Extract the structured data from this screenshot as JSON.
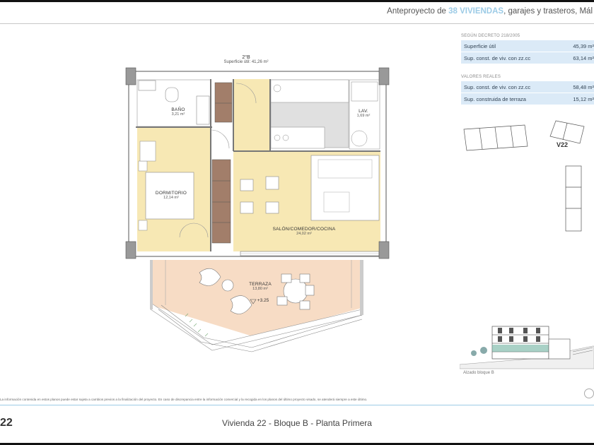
{
  "header": {
    "title_pre": "Anteproyecto de ",
    "title_highlight": "38 VIVIENDAS",
    "title_post": ", garajes y trasteros, Mál"
  },
  "plan": {
    "unit_label": "2°B",
    "unit_area": "Superficie útil: 41,26 m²",
    "rooms": [
      {
        "name": "BAÑO",
        "area": "3,21 m²"
      },
      {
        "name": "LAV.",
        "area": "1,69 m²"
      },
      {
        "name": "DORMITORIO",
        "area": "12,14 m²"
      },
      {
        "name": "SALÓN/COMEDOR/COCINA",
        "area": "24,02 m²"
      },
      {
        "name": "TERRAZA",
        "area": "13,80 m²"
      }
    ],
    "level": "+3.25"
  },
  "decree_table": {
    "caption": "SEGÚN DECRETO 218/2005",
    "rows": [
      {
        "label": "Superficie útil",
        "value": "45,39 m²"
      },
      {
        "label": "Sup. const. de viv. con zz.cc",
        "value": "63,14 m²"
      }
    ]
  },
  "real_table": {
    "caption": "VALORES REALES",
    "rows": [
      {
        "label": "Sup. const. de viv. con zz.cc",
        "value": "58,48 m²"
      },
      {
        "label": "Sup. construida de terraza",
        "value": "15,12 m²"
      }
    ]
  },
  "key_plan_label": "V22",
  "elevation_caption": "Alzado bloque B",
  "disclaimer": "La información contenida en estos planos puede estar sujeta a cambios previos a la finalización del proyecto. En caso de discrepancia entre la información comercial y la recogida en los planos del último proyecto visado, se atenderá siempre a este último.",
  "footer": {
    "unit_number": "22",
    "title": "Vivienda 22 - Bloque B - Planta Primera"
  },
  "colors": {
    "accent": "#9ccbe6",
    "bedroom_fill": "#f7e8b4",
    "terrace_fill": "#f7dcc5",
    "table_fill": "#dbeaf7"
  }
}
